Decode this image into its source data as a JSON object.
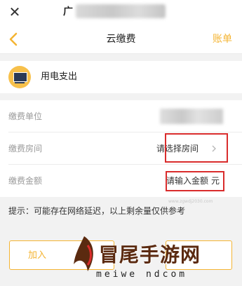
{
  "topbar": {
    "title": "广"
  },
  "nav": {
    "title": "云缴费",
    "right_label": "账单"
  },
  "header": {
    "label": "用电支出"
  },
  "form": {
    "unit_label": "缴费单位",
    "room_label": "缴费房间",
    "room_value": "请选择房间",
    "amount_label": "缴费金额",
    "amount_placeholder": "请输入金额",
    "amount_unit": "元"
  },
  "hint": "提示：可能存在网络延迟，以上剩余量仅供参考",
  "actions": {
    "add_label": "加入"
  },
  "watermark": {
    "text": "冒尾手游网",
    "url": "meiwe ndcom",
    "small_url": "www.zgwdj2030.com"
  },
  "colors": {
    "accent": "#f4b433",
    "highlight": "#d92c2c"
  },
  "icons": [
    "close-icon",
    "back-icon",
    "tv-icon",
    "chevron-right-icon"
  ]
}
